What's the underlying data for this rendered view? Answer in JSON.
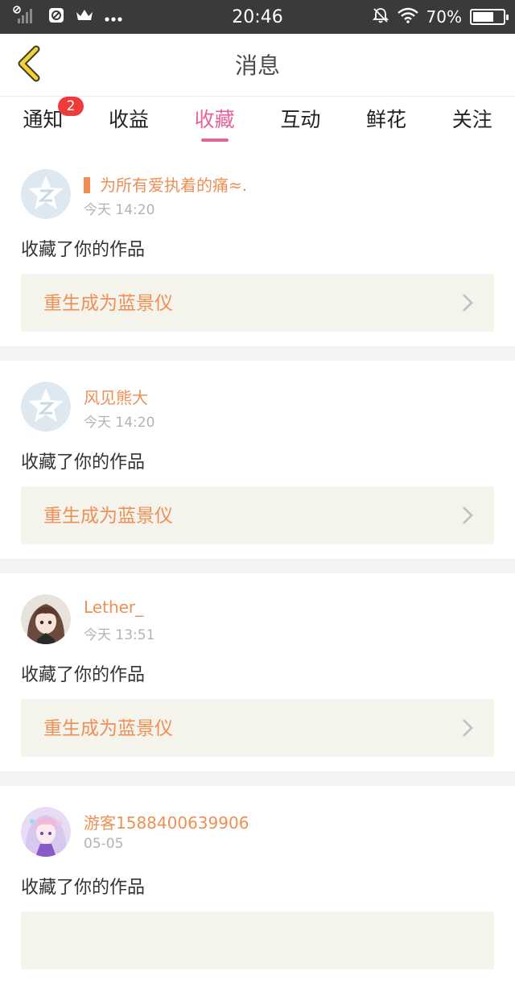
{
  "status_bar": {
    "time": "20:46",
    "battery": "70%",
    "battery_level": 0.7,
    "icons_left": [
      "no-signal-icon",
      "app-notification-icon",
      "crown-icon",
      "more-dots-icon"
    ],
    "icons_right": [
      "mute-bell-icon",
      "wifi-icon",
      "battery-icon"
    ]
  },
  "header": {
    "title": "消息",
    "back_icon": "chevron-left-icon"
  },
  "tabs": [
    {
      "label": "通知",
      "badge": "2",
      "active": false
    },
    {
      "label": "收益",
      "active": false
    },
    {
      "label": "收藏",
      "active": true
    },
    {
      "label": "互动",
      "active": false
    },
    {
      "label": "鲜花",
      "active": false
    },
    {
      "label": "关注",
      "active": false
    }
  ],
  "colors": {
    "accent_pink": "#e3649a",
    "username_orange": "#ee8f55",
    "badge_red": "#ee3b3b",
    "status_bar_bg": "#3a3a3a",
    "link_bg": "#f4f4ec"
  },
  "messages": [
    {
      "user": "为所有爱执着的痛≈.",
      "time": "今天 14:20",
      "action": "收藏了你的作品",
      "work": "重生成为蓝景仪",
      "avatar": "default-avatar-icon"
    },
    {
      "user": "风见熊大",
      "time": "今天 14:20",
      "action": "收藏了你的作品",
      "work": "重生成为蓝景仪",
      "avatar": "default-avatar-icon"
    },
    {
      "user": "Lether_",
      "time": "今天 13:51",
      "action": "收藏了你的作品",
      "work": "重生成为蓝景仪",
      "avatar": "anime-girl-avatar"
    },
    {
      "user": "游客1588400639906",
      "time": "05-05",
      "action": "收藏了你的作品",
      "work": "",
      "avatar": "anime-girl-avatar"
    }
  ]
}
